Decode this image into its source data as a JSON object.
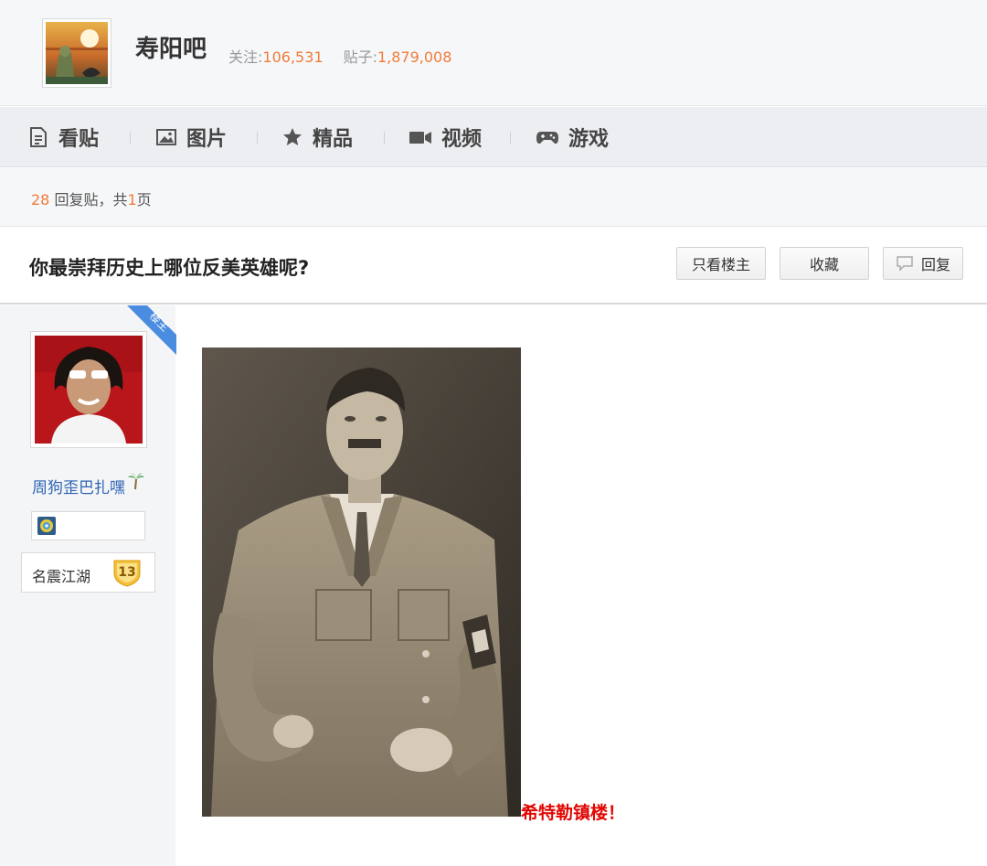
{
  "forum": {
    "name": "寿阳吧",
    "follow_label": "关注:",
    "follow_count": "106,531",
    "posts_label": "贴子:",
    "posts_count": "1,879,008"
  },
  "nav": {
    "items": [
      {
        "label": "看贴",
        "icon": "document-icon"
      },
      {
        "label": "图片",
        "icon": "image-icon"
      },
      {
        "label": "精品",
        "icon": "star-icon"
      },
      {
        "label": "视频",
        "icon": "video-camera-icon"
      },
      {
        "label": "游戏",
        "icon": "gamepad-icon"
      }
    ]
  },
  "summary": {
    "reply_count": "28",
    "reply_label": " 回复贴，共",
    "page_count": "1",
    "page_label": "页"
  },
  "thread": {
    "title": "你最崇拜历史上哪位反美英雄呢?",
    "buttons": {
      "only_op": "只看楼主",
      "favorite": "收藏",
      "reply": "回复"
    }
  },
  "post": {
    "badge": "楼主",
    "author": "周狗歪巴扎嘿",
    "level_name": "名震江湖",
    "level": "13",
    "caption": "希特勒镇楼！"
  },
  "colors": {
    "accent_orange": "#f07c3a",
    "link_blue": "#2d64b3",
    "caption_red": "#e10602",
    "badge_blue": "#4a8ce0"
  }
}
